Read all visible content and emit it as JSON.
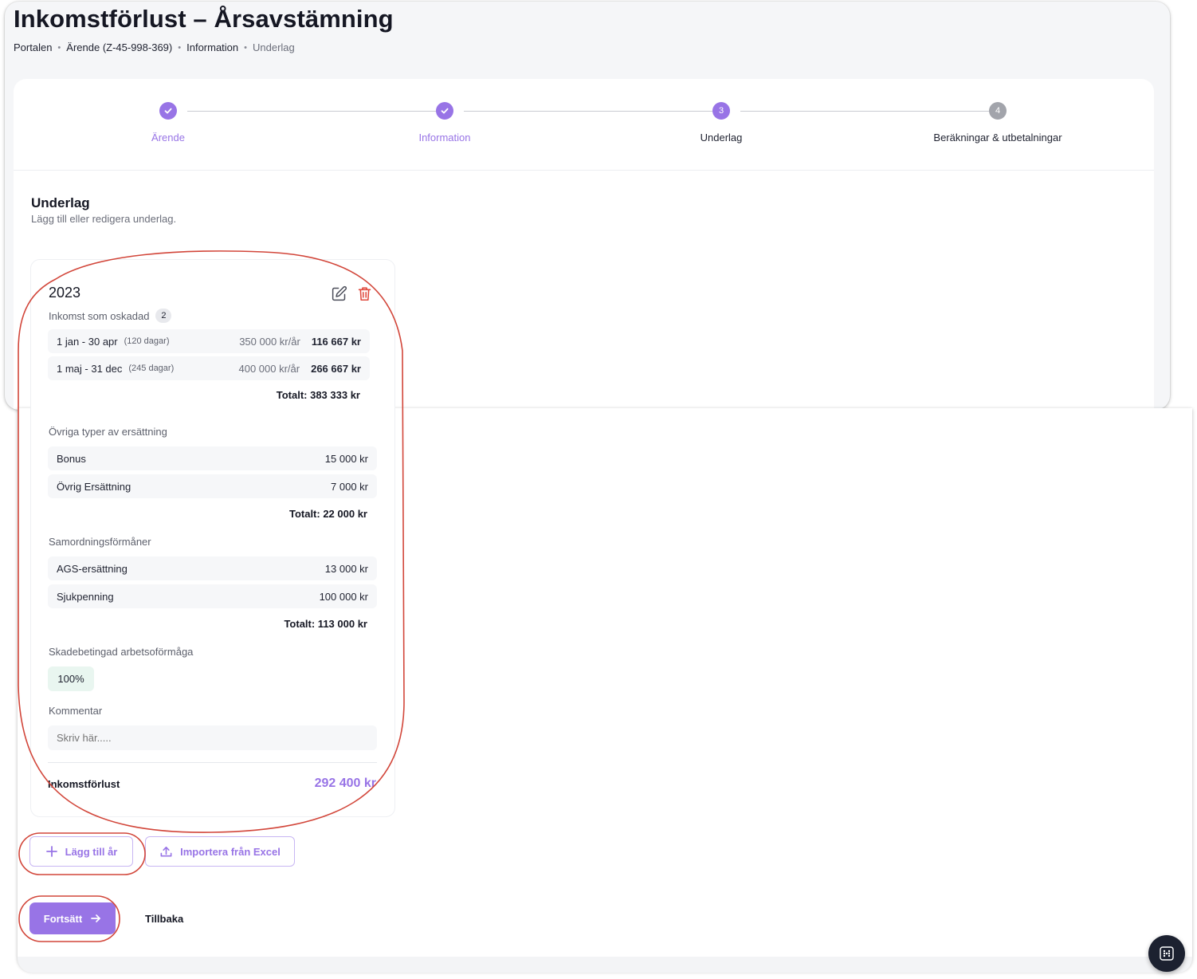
{
  "header": {
    "title": "Inkomstförlust – Årsavstämning",
    "breadcrumb": [
      "Portalen",
      "Ärende (Z-45-998-369)",
      "Information",
      "Underlag"
    ]
  },
  "stepper": {
    "steps": [
      {
        "label": "Ärende",
        "state": "done",
        "marker": ""
      },
      {
        "label": "Information",
        "state": "done",
        "marker": ""
      },
      {
        "label": "Underlag",
        "state": "active",
        "marker": "3"
      },
      {
        "label": "Beräkningar & utbetalningar",
        "state": "todo",
        "marker": "4"
      }
    ]
  },
  "section": {
    "title": "Underlag",
    "subtitle": "Lägg till eller redigera underlag."
  },
  "year_card": {
    "year": "2023",
    "income": {
      "label": "Inkomst som oskadad",
      "count": "2",
      "rows": [
        {
          "period": "1 jan - 30 apr",
          "days": "(120 dagar)",
          "rate": "350 000 kr/år",
          "amount": "116 667 kr"
        },
        {
          "period": "1 maj - 31 dec",
          "days": "(245 dagar)",
          "rate": "400 000 kr/år",
          "amount": "266 667 kr"
        }
      ],
      "total": "Totalt: 383 333 kr"
    },
    "other_compensation": {
      "label": "Övriga typer av ersättning",
      "rows": [
        {
          "label": "Bonus",
          "value": "15 000 kr"
        },
        {
          "label": "Övrig Ersättning",
          "value": "7 000 kr"
        }
      ],
      "total": "Totalt: 22 000 kr"
    },
    "coordination_benefits": {
      "label": "Samordningsförmåner",
      "rows": [
        {
          "label": "AGS-ersättning",
          "value": "13 000 kr"
        },
        {
          "label": "Sjukpenning",
          "value": "100 000 kr"
        }
      ],
      "total": "Totalt: 113 000 kr"
    },
    "work_capacity": {
      "label": "Skadebetingad arbetsoförmåga",
      "value": "100%"
    },
    "comment": {
      "label": "Kommentar",
      "placeholder": "Skriv här....."
    },
    "income_loss": {
      "label": "Inkomstförlust",
      "value": "292 400 kr"
    }
  },
  "actions": {
    "add_year": "Lägg till år",
    "import_excel": "Importera från Excel",
    "continue": "Fortsätt",
    "back": "Tillbaka"
  },
  "colors": {
    "accent": "#9874e6",
    "annotation": "#d2463a",
    "delete": "#e0483c"
  },
  "icons": [
    "check-icon",
    "edit-icon",
    "trash-icon",
    "plus-icon",
    "upload-icon",
    "arrow-right-icon",
    "grid-dots-icon"
  ]
}
